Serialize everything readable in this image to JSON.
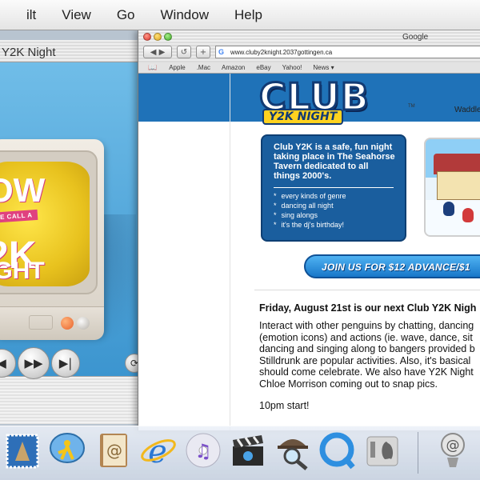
{
  "menubar": {
    "items": [
      "ilt",
      "View",
      "Go",
      "Window",
      "Help"
    ]
  },
  "player": {
    "title": "Y2K Night",
    "tv_lines": [
      "OW",
      "2K",
      "IGHT"
    ],
    "tv_banner": "WE CALL A",
    "controls": [
      "◀",
      "▶▶",
      "▶|",
      "⟳"
    ]
  },
  "browser": {
    "title": "Google",
    "url": "www.cluby2knight.2037gottingen.ca",
    "url_icon": "G",
    "nav": {
      "back": "◀ ▶",
      "reload": "↺",
      "add": "+"
    },
    "bookmarks_icon": "📖",
    "bookmarks": [
      "Apple",
      ".Mac",
      "Amazon",
      "eBay",
      "Yahoo!",
      "News ▾"
    ]
  },
  "page": {
    "logo_club": "CLUB",
    "logo_y2k": "Y2K NIGHT",
    "logo_tm": "TM",
    "waddle": "Waddle",
    "info_intro": "Club Y2K is a safe, fun night taking place in The Seahorse Tavern dedicated to all things 2000's.",
    "info_items": [
      "every kinds of genre",
      "dancing all night",
      "sing alongs",
      "it's the dj's birthday!"
    ],
    "join_label": "JOIN US FOR $12 ADVANCE/$1",
    "event_title": "Friday, August 21st is our next Club Y2K Nigh",
    "event_body": [
      "Interact with other penguins by chatting, dancing",
      "(emotion icons) and actions (ie. wave, dance, sit",
      "dancing and singing along to bangers provided b",
      "Stilldrunk are popular activities. Also, it's basical",
      "should come celebrate. We also have Y2K Night",
      "Chloe Morrison coming out to snap pics."
    ],
    "event_start": "10pm start!"
  },
  "dock": {
    "items": [
      "mail-stamp-icon",
      "ichat-icon",
      "address-book-icon",
      "internet-explorer-icon",
      "itunes-icon",
      "imovie-icon",
      "sherlock-icon",
      "quicktime-icon",
      "system-preferences-icon",
      "mail-icon"
    ]
  },
  "colors": {
    "page_blue": "#1f72b8",
    "info_box": "#1a5e9e",
    "logo_yellow": "#ffd21f",
    "player_sky": "#5fa7d6"
  }
}
